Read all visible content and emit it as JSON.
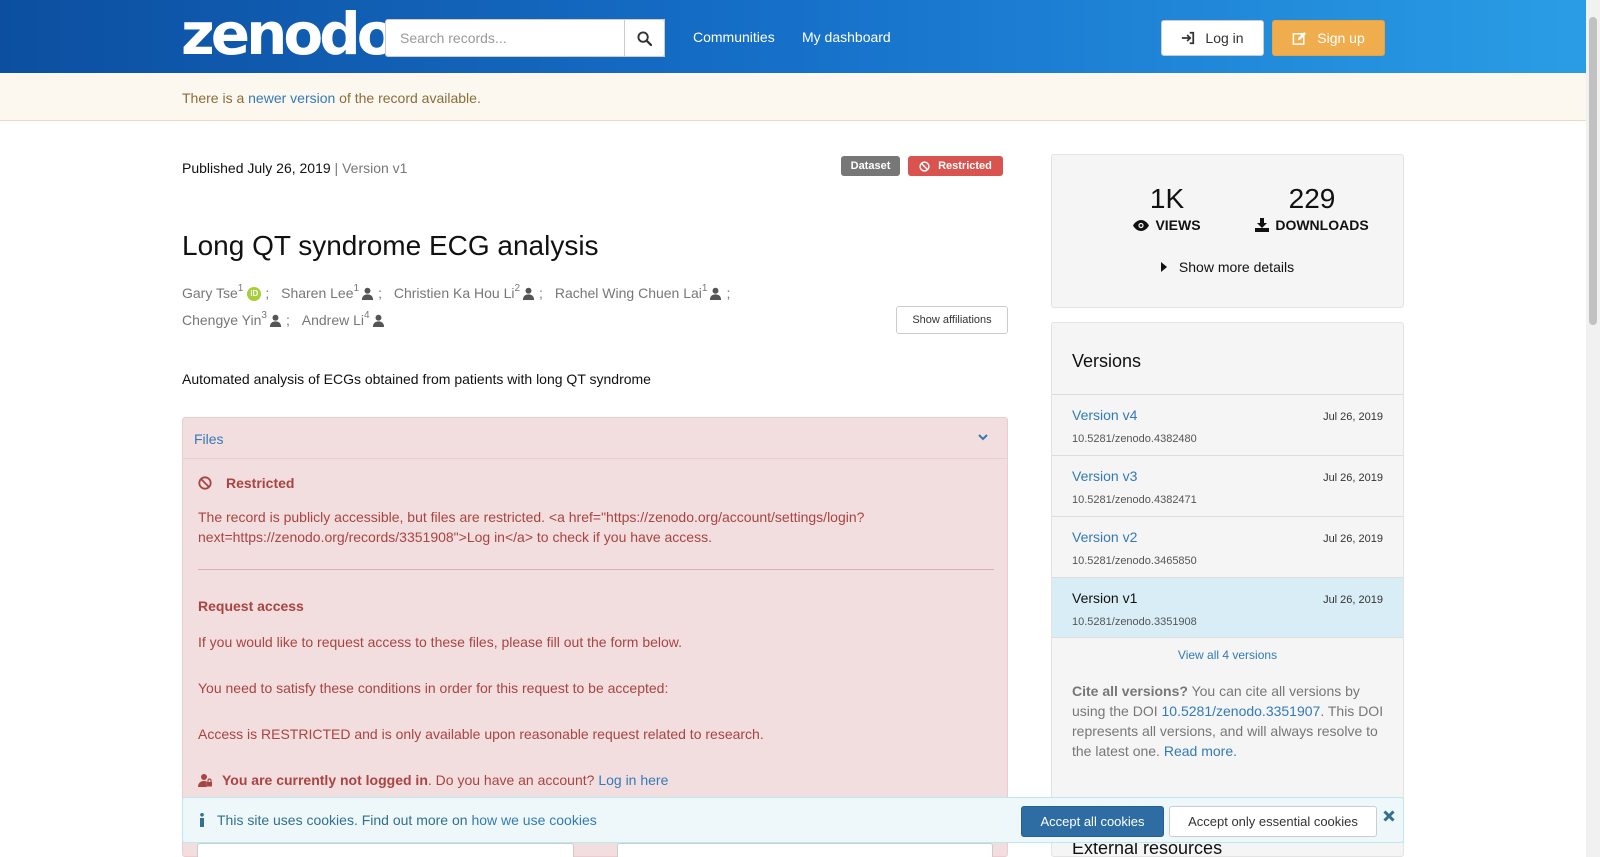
{
  "header": {
    "logo": "zenodo",
    "search_placeholder": "Search records...",
    "nav": [
      "Communities",
      "My dashboard"
    ],
    "login_label": "Log in",
    "signup_label": "Sign up"
  },
  "notice": {
    "prefix": "There is a ",
    "link": "newer version",
    "suffix": " of the record available."
  },
  "record": {
    "published": "Published July 26, 2019",
    "version_sep": " | Version v1",
    "badge_type": "Dataset",
    "badge_access": "Restricted",
    "title": "Long QT syndrome ECG analysis",
    "authors": [
      {
        "name": "Gary Tse",
        "sup": "1"
      },
      {
        "name": "Sharen Lee",
        "sup": "1"
      },
      {
        "name": "Christien Ka Hou Li",
        "sup": "2"
      },
      {
        "name": "Rachel Wing Chuen Lai",
        "sup": "1"
      },
      {
        "name": "Chengye Yin",
        "sup": "3"
      },
      {
        "name": "Andrew Li",
        "sup": "4"
      }
    ],
    "show_affiliations": "Show affiliations",
    "description": "Automated analysis of ECGs obtained from patients with long QT syndrome"
  },
  "files": {
    "header": "Files",
    "restricted_title": "Restricted",
    "restricted_msg": "The record is publicly accessible, but files are restricted. <a href=\"https://zenodo.org/account/settings/login?next=https://zenodo.org/records/3351908\">Log in</a> to check if you have access.",
    "request_title": "Request access",
    "request_line1": "If you would like to request access to these files, please fill out the form below.",
    "request_line2": "You need to satisfy these conditions in order for this request to be accepted:",
    "request_line3": "Access is RESTRICTED and is only available upon reasonable request related to research.",
    "not_logged_bold": "You are currently not logged in",
    "not_logged_text": ". Do you have an account? ",
    "login_here": "Log in here"
  },
  "stats": {
    "views": "1K",
    "views_label": "VIEWS",
    "downloads": "229",
    "downloads_label": "DOWNLOADS",
    "show_more": "Show more details"
  },
  "versions": {
    "title": "Versions",
    "items": [
      {
        "label": "Version v4",
        "date": "Jul 26, 2019",
        "doi": "10.5281/zenodo.4382480"
      },
      {
        "label": "Version v3",
        "date": "Jul 26, 2019",
        "doi": "10.5281/zenodo.4382471"
      },
      {
        "label": "Version v2",
        "date": "Jul 26, 2019",
        "doi": "10.5281/zenodo.3465850"
      },
      {
        "label": "Version v1",
        "date": "Jul 26, 2019",
        "doi": "10.5281/zenodo.3351908"
      }
    ],
    "view_all": "View all 4 versions",
    "cite_bold": "Cite all versions?",
    "cite_text1": " You can cite all versions by using the DOI ",
    "cite_doi": "10.5281/zenodo.3351907",
    "cite_text2": ". This DOI represents all versions, and will always resolve to the latest one. ",
    "read_more": "Read more.",
    "external_resources": "External resources"
  },
  "cookies": {
    "text": "This site uses cookies. Find out more on ",
    "link": "how we use cookies",
    "accept_all": "Accept all cookies",
    "accept_essential": "Accept only essential cookies"
  },
  "icons": {
    "search": "search-icon",
    "login": "sign-in-icon",
    "signup": "edit-icon",
    "orcid": "orcid-icon",
    "user": "user-icon",
    "ban": "ban-icon",
    "eye": "eye-icon",
    "download": "download-icon",
    "caret": "caret-right-icon",
    "chevron": "chevron-down-icon",
    "lock": "user-lock-icon",
    "info": "info-icon",
    "close": "close-icon"
  },
  "colors": {
    "header_start": "#0c4fa0",
    "header_end": "#2a9de6",
    "signup": "#f0ad4e",
    "restricted": "#d9534f",
    "link": "#337ab7",
    "danger_text": "#a94442"
  }
}
